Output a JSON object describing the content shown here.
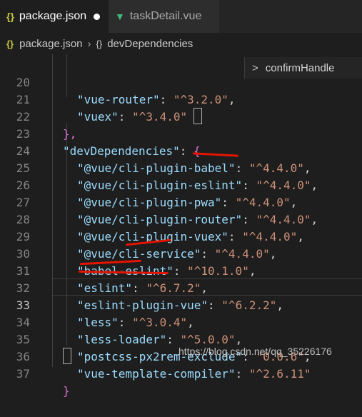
{
  "tabs": [
    {
      "label": "package.json",
      "icon": "{}",
      "active": true,
      "dirty": true
    },
    {
      "label": "taskDetail.vue",
      "icon": "V",
      "active": false
    }
  ],
  "breadcrumb": {
    "file": "package.json",
    "icon_file": "{}",
    "icon_object": "{}",
    "section": "devDependencies"
  },
  "peek": {
    "label": "confirmHandle",
    "chevron": ">"
  },
  "lines": [
    {
      "n": "20",
      "key": "\"vue-router\"",
      "value": "\"^3.2.0\"",
      "tail": ","
    },
    {
      "n": "21",
      "key": "\"vuex\"",
      "value": "\"^3.4.0\"",
      "tail": ""
    },
    {
      "n": "22",
      "text": "},"
    },
    {
      "n": "23",
      "key": "\"devDependencies\"",
      "colon": ": ",
      "brace": "{"
    },
    {
      "n": "24",
      "key": "\"@vue/cli-plugin-babel\"",
      "value": "\"^4.4.0\"",
      "tail": ","
    },
    {
      "n": "25",
      "key": "\"@vue/cli-plugin-eslint\"",
      "value": "\"^4.4.0\"",
      "tail": ","
    },
    {
      "n": "26",
      "key": "\"@vue/cli-plugin-pwa\"",
      "value": "\"^4.4.0\"",
      "tail": ","
    },
    {
      "n": "27",
      "key": "\"@vue/cli-plugin-router\"",
      "value": "\"^4.4.0\"",
      "tail": ","
    },
    {
      "n": "28",
      "key": "\"@vue/cli-plugin-vuex\"",
      "value": "\"^4.4.0\"",
      "tail": ","
    },
    {
      "n": "29",
      "key": "\"@vue/cli-service\"",
      "value": "\"^4.4.0\"",
      "tail": ","
    },
    {
      "n": "30",
      "key": "\"babel-eslint\"",
      "value": "\"^10.1.0\"",
      "tail": ","
    },
    {
      "n": "31",
      "key": "\"eslint\"",
      "value": "\"^6.7.2\"",
      "tail": ","
    },
    {
      "n": "32",
      "key": "\"eslint-plugin-vue\"",
      "value": "\"^6.2.2\"",
      "tail": ","
    },
    {
      "n": "33",
      "key": "\"less\"",
      "value": "\"^3.0.4\"",
      "tail": ","
    },
    {
      "n": "34",
      "key": "\"less-loader\"",
      "value": "\"^5.0.0\"",
      "tail": ","
    },
    {
      "n": "35",
      "key": "\"postcss-px2rem-exclude\"",
      "value": "\"0.0.6\"",
      "tail": ","
    },
    {
      "n": "36",
      "key": "\"vue-template-compiler\"",
      "value": "\"^2.6.11\"",
      "tail": ""
    },
    {
      "n": "37",
      "text": "}"
    }
  ],
  "watermark": "https://blog.csdn.net/qq_35226176",
  "colors": {
    "key": "#9cdcfe",
    "string": "#ce9178",
    "annotation": "#e51400"
  }
}
